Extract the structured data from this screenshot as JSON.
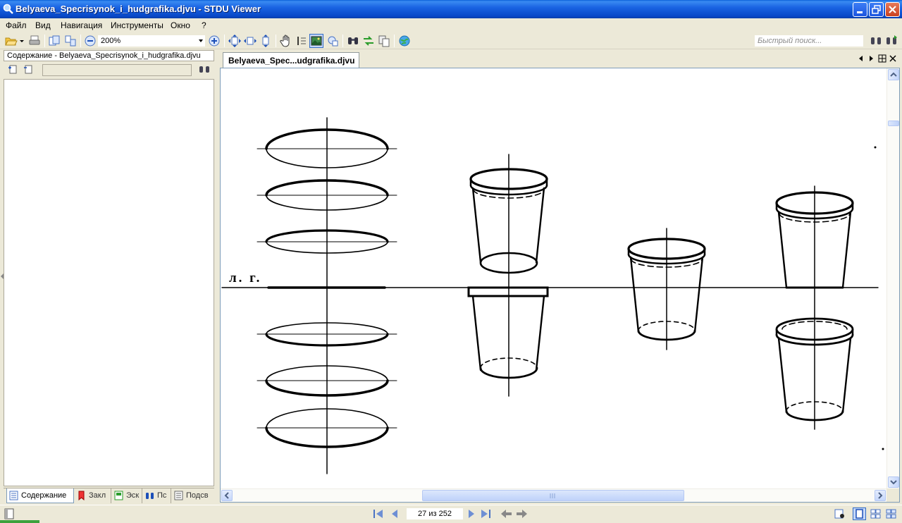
{
  "window": {
    "title": "Belyaeva_Specrisynok_i_hudgrafika.djvu - STDU Viewer"
  },
  "menu": {
    "items": [
      {
        "label": "Файл"
      },
      {
        "label": "Вид"
      },
      {
        "label": "Навигация"
      },
      {
        "label": "Инструменты"
      },
      {
        "label": "Окно"
      },
      {
        "label": "?"
      }
    ]
  },
  "toolbar": {
    "zoom_value": "200%",
    "search_placeholder": "Быстрый поиск..."
  },
  "left_panel": {
    "header": "Содержание - Belyaeva_Specrisynok_i_hudgrafika.djvu",
    "tabs": [
      {
        "label": "Содержание",
        "active": true
      },
      {
        "label": "Закл"
      },
      {
        "label": "Эск"
      },
      {
        "label": "Пс"
      },
      {
        "label": "Подсв"
      }
    ]
  },
  "document": {
    "tab_label": "Belyaeva_Spec...udgrafika.djvu",
    "page_text_label": "л. г."
  },
  "status": {
    "page_indicator": "27 из 252"
  },
  "colors": {
    "titlebar": "#0a5fd8",
    "chrome": "#ece9d8",
    "scroll_accent": "#c6d7fb"
  }
}
